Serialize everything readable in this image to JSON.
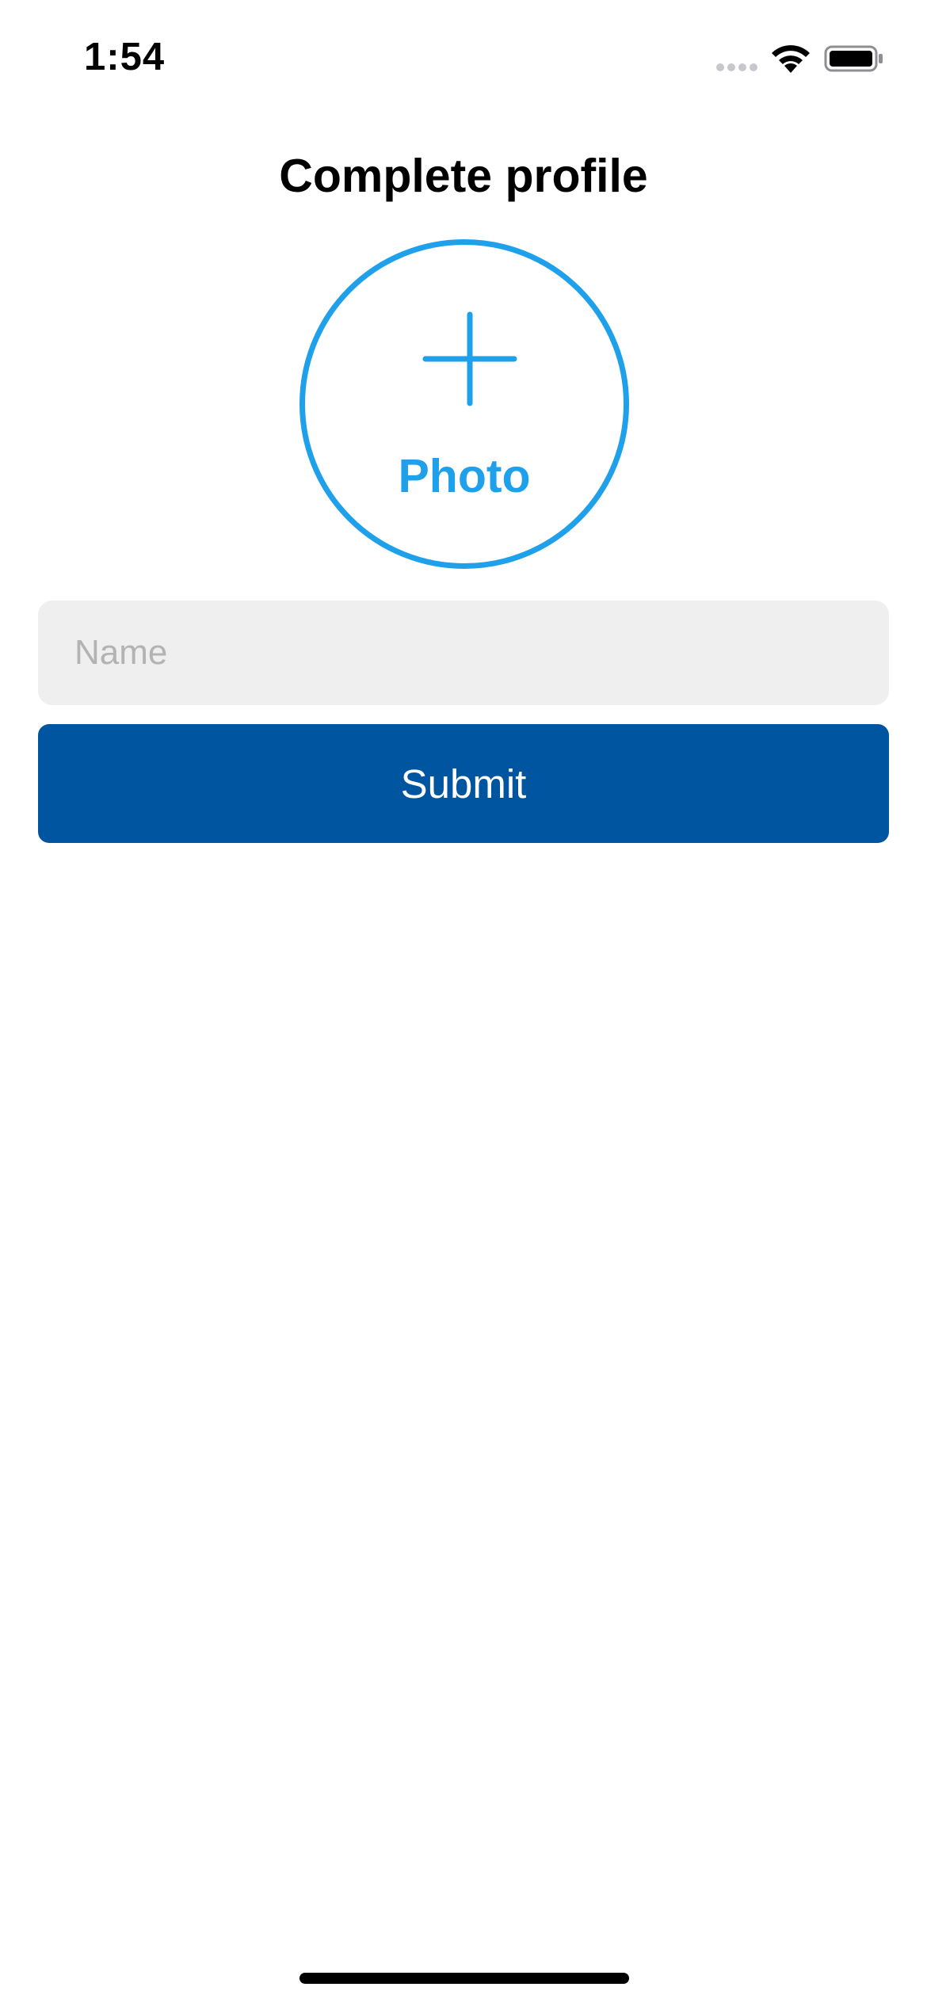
{
  "status_bar": {
    "time": "1:54",
    "icons": [
      "cellular-signal-icon",
      "wifi-icon",
      "battery-icon"
    ]
  },
  "header": {
    "title": "Complete profile"
  },
  "photo_picker": {
    "icon": "plus-icon",
    "label": "Photo",
    "color": "#1fa0ea"
  },
  "form": {
    "name_input": {
      "value": "",
      "placeholder": "Name"
    },
    "submit_label": "Submit",
    "submit_color": "#0055a1"
  }
}
